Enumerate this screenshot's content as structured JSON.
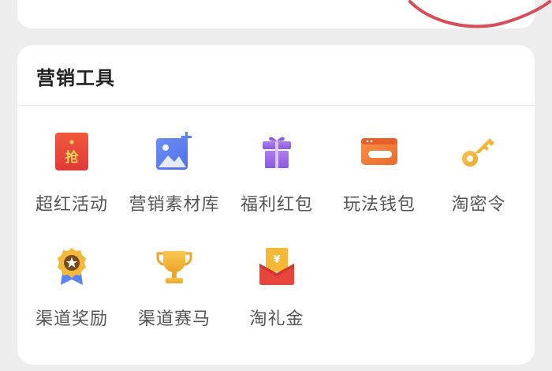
{
  "section": {
    "title": "营销工具"
  },
  "tools": [
    {
      "label": "超红活动",
      "icon": "red-packet-icon",
      "icon_text": "抢"
    },
    {
      "label": "营销素材库",
      "icon": "image-add-icon"
    },
    {
      "label": "福利红包",
      "icon": "gift-icon"
    },
    {
      "label": "玩法钱包",
      "icon": "wallet-icon"
    },
    {
      "label": "淘密令",
      "icon": "key-icon"
    },
    {
      "label": "渠道奖励",
      "icon": "medal-icon"
    },
    {
      "label": "渠道赛马",
      "icon": "trophy-icon"
    },
    {
      "label": "淘礼金",
      "icon": "gift-envelope-icon",
      "icon_text": "¥"
    }
  ],
  "colors": {
    "red": "#e8453c",
    "blue": "#5b82f0",
    "purple": "#9b6be8",
    "orange": "#f07a34",
    "gold": "#f3b53a",
    "annotation": "#d94a5a"
  }
}
